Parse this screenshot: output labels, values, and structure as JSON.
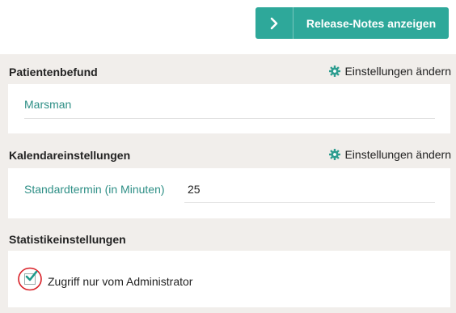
{
  "header": {
    "release_button_label": "Release-Notes anzeigen",
    "release_button_icon": "chevron-right-icon"
  },
  "sections": {
    "patient": {
      "title": "Patientenbefund",
      "action_label": "Einstellungen ändern",
      "action_icon": "gear-icon",
      "field_link": "Marsman"
    },
    "calendar": {
      "title": "Kalendareinstellungen",
      "action_label": "Einstellungen ändern",
      "action_icon": "gear-icon",
      "field_label": "Standardtermin (in Minuten)",
      "field_value": "25"
    },
    "statistics": {
      "title": "Statistikeinstellungen",
      "checkbox_label": "Zugriff nur vom Administrator",
      "checkbox_checked": true
    }
  },
  "colors": {
    "accent": "#2ea89a",
    "link": "#2e8f86",
    "background": "#f1eeeb",
    "annotation_circle": "#d81f26"
  }
}
